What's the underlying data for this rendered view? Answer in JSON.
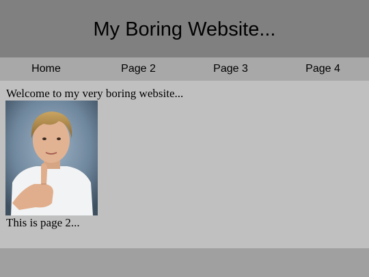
{
  "header": {
    "title": "My Boring Website..."
  },
  "nav": {
    "items": [
      {
        "label": "Home"
      },
      {
        "label": "Page 2"
      },
      {
        "label": "Page 3"
      },
      {
        "label": "Page 4"
      }
    ]
  },
  "main": {
    "welcome_text": "Welcome to my very boring website...",
    "photo_description_icon": "boy-thumbs-up-photo",
    "page_note": "This is page 2..."
  },
  "colors": {
    "header_bg": "#808080",
    "nav_bg": "#a8a8a8",
    "content_bg": "#c0c0c0",
    "footer_bg": "#a0a0a0"
  }
}
